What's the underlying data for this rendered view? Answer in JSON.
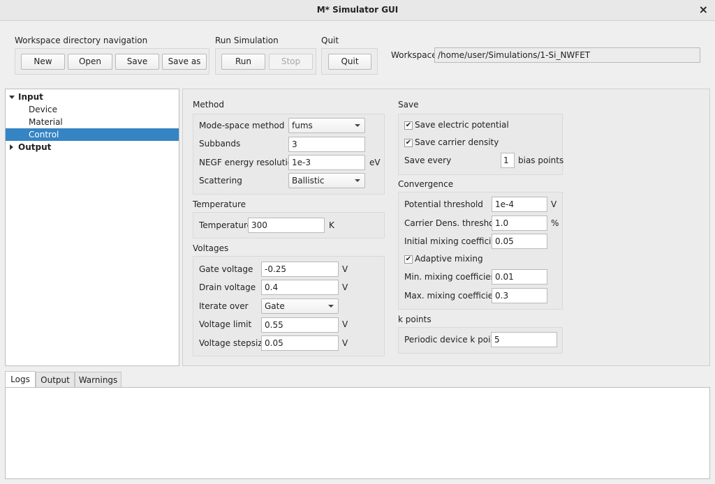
{
  "window": {
    "title": "M* Simulator GUI",
    "close_glyph": "×"
  },
  "toolbar": {
    "nav_label": "Workspace directory navigation",
    "new": "New",
    "open": "Open",
    "save": "Save",
    "save_as": "Save as",
    "run_label": "Run Simulation",
    "run": "Run",
    "stop": "Stop",
    "quit_label": "Quit",
    "quit": "Quit",
    "workspace_label": "Workspace",
    "workspace_path": "/home/user/Simulations/1-Si_NWFET"
  },
  "tree": {
    "input": "Input",
    "device": "Device",
    "material": "Material",
    "control": "Control",
    "output": "Output",
    "selected": "Control"
  },
  "method": {
    "title": "Method",
    "mode_space_label": "Mode-space method",
    "mode_space_value": "fums",
    "subbands_label": "Subbands",
    "subbands_value": "3",
    "negf_label": "NEGF energy resolution",
    "negf_value": "1e-3",
    "negf_unit": "eV",
    "scattering_label": "Scattering",
    "scattering_value": "Ballistic"
  },
  "temperature": {
    "title": "Temperature",
    "label": "Temperature",
    "value": "300",
    "unit": "K"
  },
  "voltages": {
    "title": "Voltages",
    "gate_label": "Gate voltage",
    "gate_value": "-0.25",
    "gate_unit": "V",
    "drain_label": "Drain voltage",
    "drain_value": "0.4",
    "drain_unit": "V",
    "iterate_label": "Iterate over",
    "iterate_value": "Gate",
    "limit_label": "Voltage limit",
    "limit_value": "0.55",
    "limit_unit": "V",
    "step_label": "Voltage stepsize",
    "step_value": "0.05",
    "step_unit": "V"
  },
  "save": {
    "title": "Save",
    "potential_label": "Save electric potential",
    "potential_checked": true,
    "density_label": "Save carrier density",
    "density_checked": true,
    "every_label": "Save every",
    "every_value": "1",
    "every_unit": "bias points"
  },
  "convergence": {
    "title": "Convergence",
    "potential_label": "Potential threshold",
    "potential_value": "1e-4",
    "potential_unit": "V",
    "carrier_label": "Carrier Dens. threshold",
    "carrier_value": "1.0",
    "carrier_unit": "%",
    "initial_label": "Initial mixing coefficient",
    "initial_value": "0.05",
    "adaptive_label": "Adaptive mixing",
    "adaptive_checked": true,
    "min_label": "Min. mixing coefficient",
    "min_value": "0.01",
    "max_label": "Max. mixing coefficient",
    "max_value": "0.3"
  },
  "kpoints": {
    "title": "k points",
    "label": "Periodic device k points",
    "value": "5"
  },
  "tabs": {
    "logs": "Logs",
    "output": "Output",
    "warnings": "Warnings",
    "active": "Logs"
  },
  "icons": {
    "check": "check-icon",
    "expand": "triangle-down-icon",
    "collapse": "triangle-right-icon"
  }
}
